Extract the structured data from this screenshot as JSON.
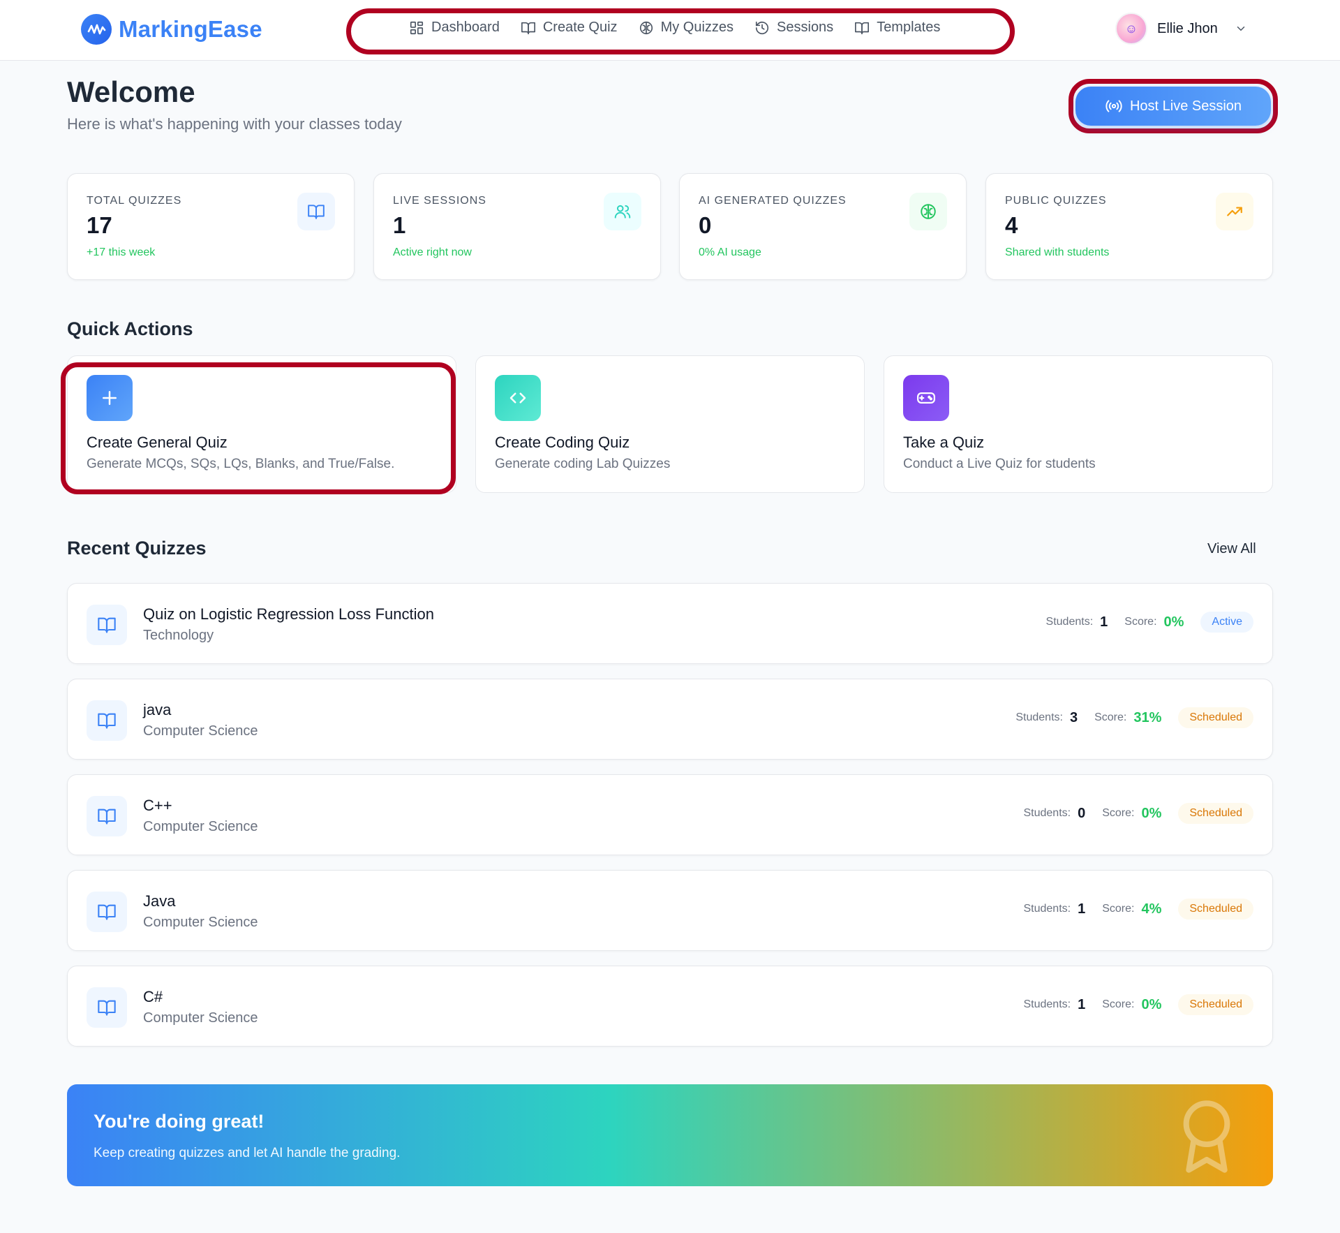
{
  "brand": {
    "name": "MarkingEase",
    "logo_icon": "waveform-icon"
  },
  "nav": [
    {
      "label": "Dashboard",
      "icon": "grid-icon"
    },
    {
      "label": "Create Quiz",
      "icon": "book-icon"
    },
    {
      "label": "My Quizzes",
      "icon": "brain-icon"
    },
    {
      "label": "Sessions",
      "icon": "history-icon"
    },
    {
      "label": "Templates",
      "icon": "book-icon"
    }
  ],
  "user": {
    "name": "Ellie Jhon"
  },
  "welcome": {
    "title": "Welcome",
    "subtitle": "Here is what's happening with your classes today"
  },
  "host_button": {
    "label": "Host Live Session"
  },
  "stats": [
    {
      "label": "TOTAL QUIZZES",
      "value": "17",
      "note": "+17 this week",
      "icon": "book-icon",
      "color": "#3b82f6"
    },
    {
      "label": "LIVE SESSIONS",
      "value": "1",
      "note": "Active right now",
      "icon": "users-icon",
      "color": "#2dd4bf"
    },
    {
      "label": "AI GENERATED QUIZZES",
      "value": "0",
      "note": "0% AI usage",
      "icon": "brain-icon",
      "color": "#22c55e"
    },
    {
      "label": "PUBLIC QUIZZES",
      "value": "4",
      "note": "Shared with students",
      "icon": "trending-up-icon",
      "color": "#f59e0b"
    }
  ],
  "quick_actions": {
    "title": "Quick Actions",
    "items": [
      {
        "title": "Create General Quiz",
        "desc": "Generate MCQs, SQs, LQs, Blanks, and True/False.",
        "icon": "plus-icon"
      },
      {
        "title": "Create Coding Quiz",
        "desc": "Generate coding Lab Quizzes",
        "icon": "code-icon"
      },
      {
        "title": "Take a Quiz",
        "desc": "Conduct a Live Quiz for students",
        "icon": "gamepad-icon"
      }
    ]
  },
  "recent": {
    "title": "Recent Quizzes",
    "view_all": "View All",
    "students_label": "Students:",
    "score_label": "Score:",
    "rows": [
      {
        "title": "Quiz on Logistic Regression Loss Function",
        "subject": "Technology",
        "students": "1",
        "score": "0%",
        "status": "Active"
      },
      {
        "title": "java",
        "subject": "Computer Science",
        "students": "3",
        "score": "31%",
        "status": "Scheduled"
      },
      {
        "title": "C++",
        "subject": "Computer Science",
        "students": "0",
        "score": "0%",
        "status": "Scheduled"
      },
      {
        "title": "Java",
        "subject": "Computer Science",
        "students": "1",
        "score": "4%",
        "status": "Scheduled"
      },
      {
        "title": "C#",
        "subject": "Computer Science",
        "students": "1",
        "score": "0%",
        "status": "Scheduled"
      }
    ]
  },
  "banner": {
    "title": "You're doing great!",
    "subtitle": "Keep creating quizzes and let AI handle the grading.",
    "icon": "award-icon"
  }
}
